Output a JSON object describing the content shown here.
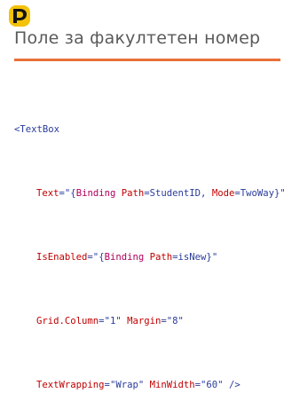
{
  "slide": {
    "title": "Поле за факултетен номер"
  },
  "code": {
    "open_tag": "<TextBox",
    "attrs": [
      {
        "name": "Text",
        "eq": "=",
        "q_open": "\"",
        "brace_open": "{",
        "keyword": "Binding",
        "p1": "Path",
        "p1eq": "=",
        "p1val": "StudentID",
        "sep": ", ",
        "p2": "Mode",
        "p2eq": "=",
        "p2val": "TwoWay",
        "brace_close": "}",
        "q_close": "\""
      },
      {
        "name": "IsEnabled",
        "eq": "=",
        "q_open": "\"",
        "brace_open": "{",
        "keyword": "Binding",
        "p1": "Path",
        "p1eq": "=",
        "p1val": "isNew",
        "brace_close": "}",
        "q_close": "\""
      }
    ],
    "line4": {
      "a1": "Grid.Column",
      "a1eq": "=",
      "a1val": "\"1\"",
      "a2": "Margin",
      "a2eq": "=",
      "a2val": "\"8\""
    },
    "line5": {
      "a1": "TextWrapping",
      "a1eq": "=",
      "a1val": "\"Wrap\"",
      "a2": "MinWidth",
      "a2eq": "=",
      "a2val": "\"60\"",
      "close": "/>"
    }
  },
  "colors": {
    "accent_rule": "#e8703a",
    "title_text": "#5a5a5a",
    "code_blue": "#2a3c9b",
    "code_red": "#c00000"
  },
  "icons": {
    "logo": "rounded-shield-logo-icon"
  }
}
